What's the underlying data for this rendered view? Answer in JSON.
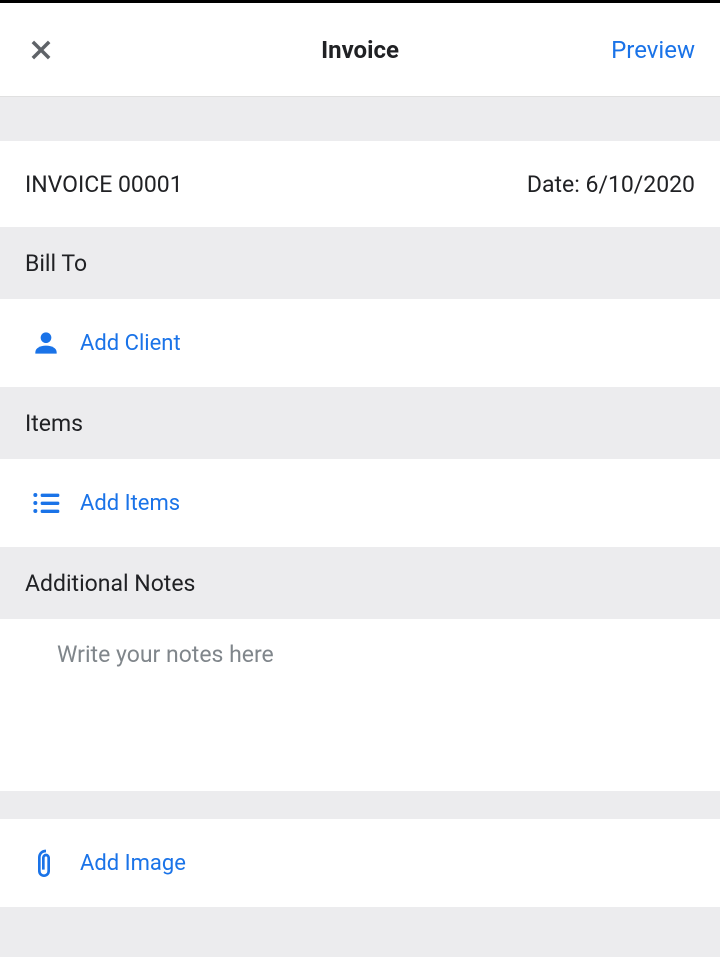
{
  "header": {
    "title": "Invoice",
    "preview_label": "Preview"
  },
  "invoice": {
    "number_label": "INVOICE 00001",
    "date_label": "Date: 6/10/2020"
  },
  "sections": {
    "bill_to": "Bill To",
    "items": "Items",
    "notes": "Additional Notes"
  },
  "actions": {
    "add_client": "Add Client",
    "add_items": "Add Items",
    "add_image": "Add Image"
  },
  "notes": {
    "placeholder": "Write your notes here"
  },
  "colors": {
    "accent": "#1a73e8",
    "text_primary": "#202124",
    "muted_bg": "#ececee"
  }
}
